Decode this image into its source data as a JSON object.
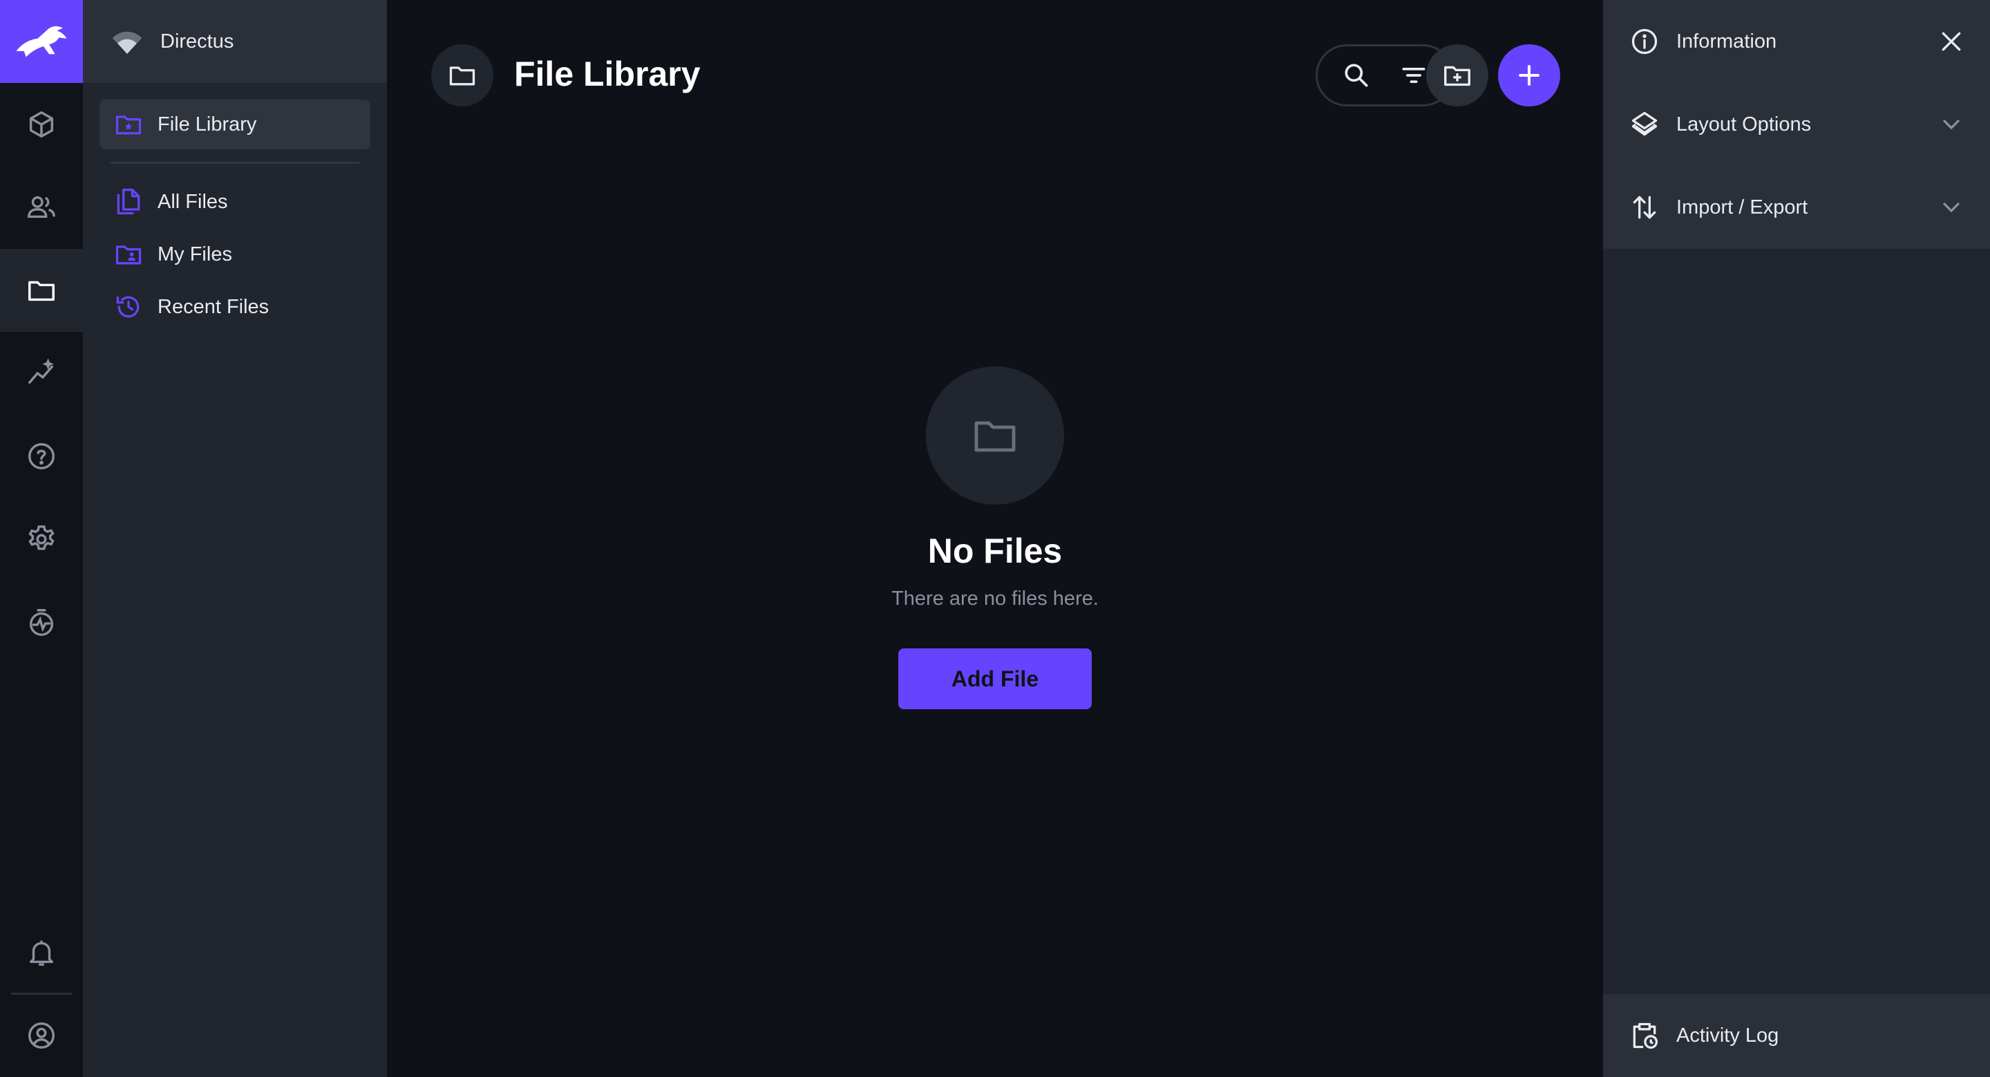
{
  "project": {
    "name": "Directus"
  },
  "nav": {
    "items": [
      {
        "label": "File Library",
        "icon": "folder-special-icon",
        "active": true
      },
      {
        "label": "All Files",
        "icon": "file-copy-icon",
        "active": false
      },
      {
        "label": "My Files",
        "icon": "folder-shared-icon",
        "active": false
      },
      {
        "label": "Recent Files",
        "icon": "history-icon",
        "active": false
      }
    ]
  },
  "modules": [
    "content-icon",
    "users-icon",
    "files-icon",
    "insights-icon",
    "help-icon",
    "settings-icon",
    "activity-icon"
  ],
  "header": {
    "title": "File Library"
  },
  "empty": {
    "title": "No Files",
    "subtitle": "There are no files here.",
    "button": "Add File"
  },
  "sidebar": {
    "information": "Information",
    "layout_options": "Layout Options",
    "import_export": "Import / Export",
    "activity_log": "Activity Log"
  },
  "colors": {
    "accent": "#6644ff",
    "background": "#0e1117",
    "nav_bg": "#21252d",
    "text": "#e8ebf0",
    "muted": "#8a909c"
  }
}
